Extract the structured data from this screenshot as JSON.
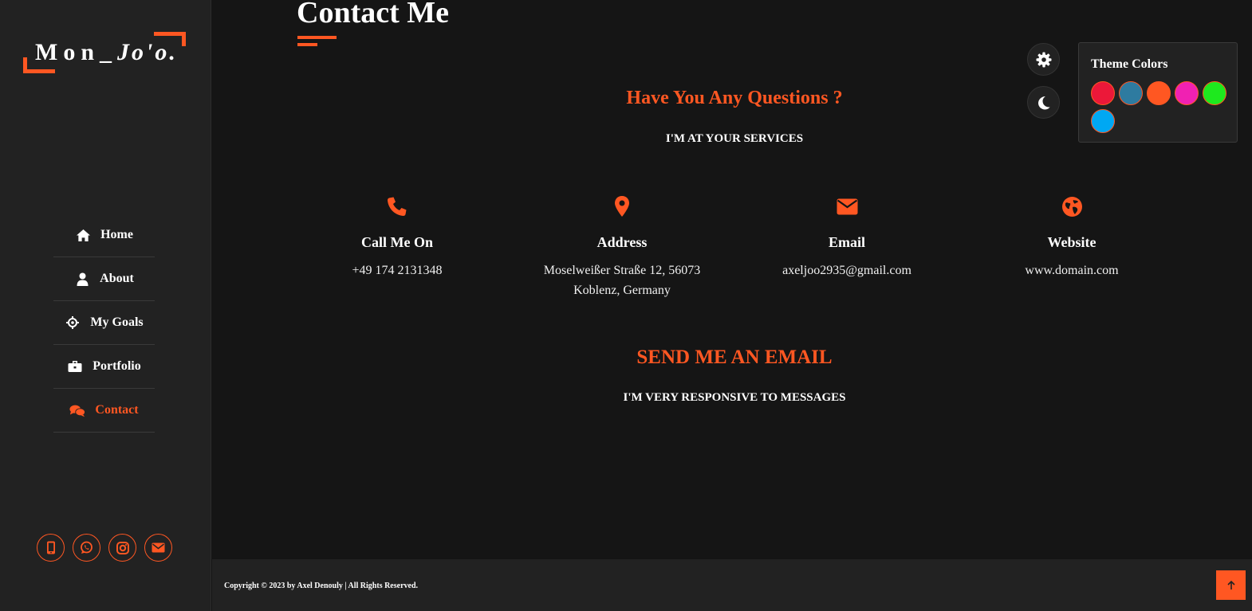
{
  "brand": {
    "logo_main": "Mon_",
    "logo_script": "Jo'o."
  },
  "nav": {
    "items": [
      {
        "label": "Home",
        "icon": "home-icon"
      },
      {
        "label": "About",
        "icon": "user-icon"
      },
      {
        "label": "My Goals",
        "icon": "crosshair-icon"
      },
      {
        "label": "Portfolio",
        "icon": "briefcase-icon"
      },
      {
        "label": "Contact",
        "icon": "comments-icon",
        "active": true
      }
    ]
  },
  "social": [
    "mobile-icon",
    "whatsapp-icon",
    "instagram-icon",
    "envelope-icon"
  ],
  "page": {
    "title": "Contact Me",
    "questions_heading": "Have You Any Questions ?",
    "questions_sub": "I'M AT YOUR SERVICES",
    "send_heading": "SEND ME AN EMAIL",
    "send_sub": "I'M VERY RESPONSIVE TO MESSAGES"
  },
  "contact_info": [
    {
      "icon": "phone-icon",
      "title": "Call Me On",
      "line1": "+49 174 2131348",
      "line2": ""
    },
    {
      "icon": "location-pin-icon",
      "title": "Address",
      "line1": "Moselweißer Straße 12, 56073",
      "line2": "Koblenz, Germany"
    },
    {
      "icon": "envelope-icon",
      "title": "Email",
      "line1": "axeljoo2935@gmail.com",
      "line2": ""
    },
    {
      "icon": "globe-icon",
      "title": "Website",
      "line1": "www.domain.com",
      "line2": ""
    }
  ],
  "theme": {
    "panel_title": "Theme Colors",
    "accent": "#ff5722",
    "colors": [
      "#ec1839",
      "#2e7ba0",
      "#ff5722",
      "#f021b2",
      "#1ee91e",
      "#00a8f3"
    ]
  },
  "footer": {
    "copyright": "Copyright © 2023 by Axel Denouly | All Rights Reserved."
  }
}
